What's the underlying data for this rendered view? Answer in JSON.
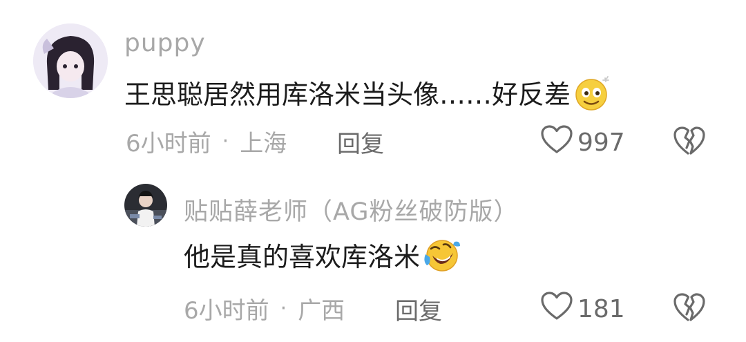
{
  "comments": [
    {
      "username": "puppy",
      "text": "王思聪居然用库洛米当头像……好反差",
      "emoji": "smiling-face-emoji",
      "time": "6小时前",
      "location": "上海",
      "reply_label": "回复",
      "likes": "997"
    }
  ],
  "replies": [
    {
      "username": "贴贴薛老师（AG粉丝破防版）",
      "text": "他是真的喜欢库洛米",
      "emoji": "rolling-laughing-emoji",
      "time": "6小时前",
      "location": "广西",
      "reply_label": "回复",
      "likes": "181"
    }
  ],
  "separator": "·",
  "icons": {
    "like": "heart-outline-icon",
    "dislike": "broken-heart-icon"
  },
  "colors": {
    "text": "#1c1c1c",
    "muted": "#a8a8a8",
    "action": "#6a6a6a"
  }
}
